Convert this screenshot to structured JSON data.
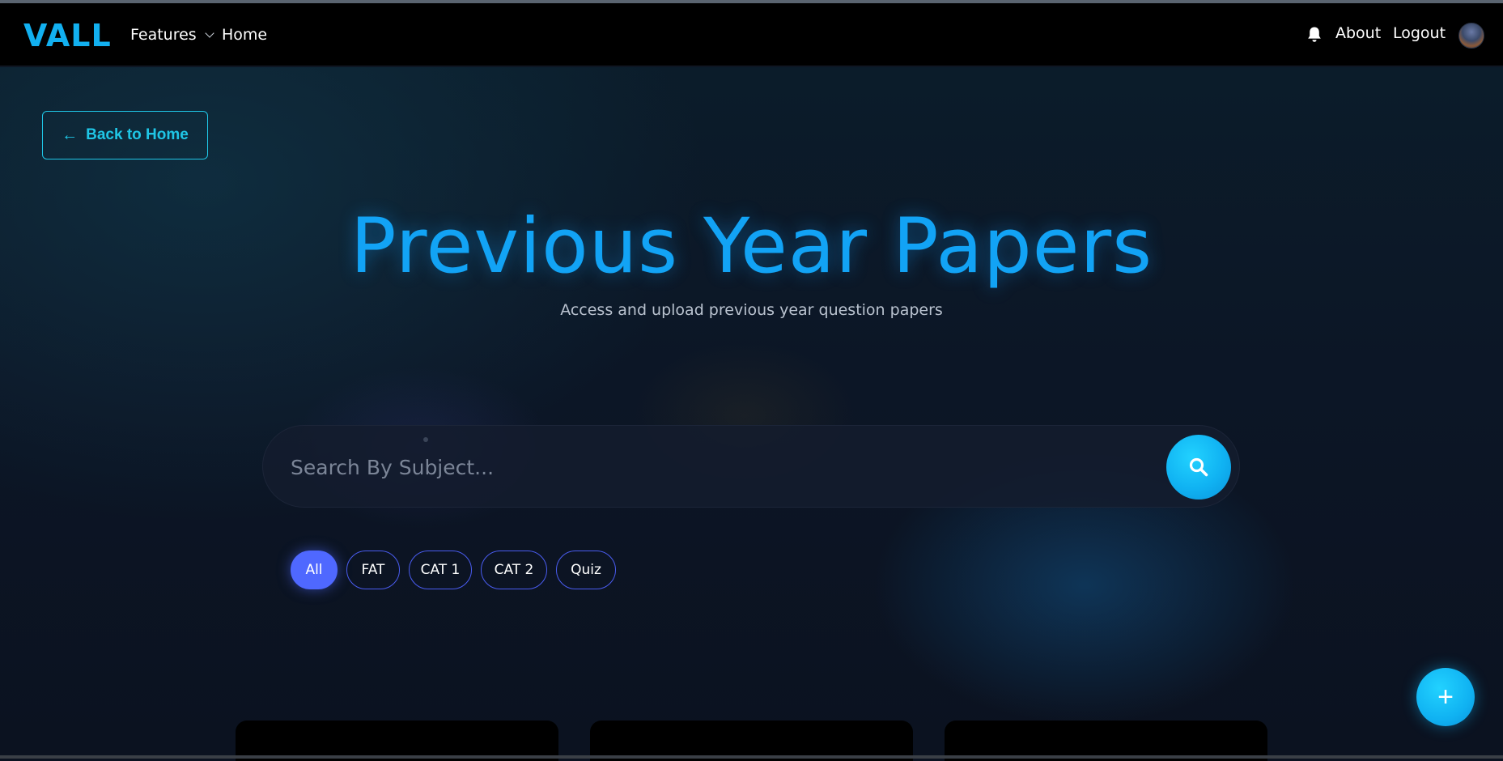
{
  "navbar": {
    "logo": "VALL",
    "features_label": "Features",
    "home_label": "Home",
    "about_label": "About",
    "logout_label": "Logout"
  },
  "back_button": {
    "arrow": "←",
    "label": "Back to Home"
  },
  "hero": {
    "title": "Previous Year Papers",
    "subtitle": "Access and upload previous year question papers"
  },
  "search": {
    "placeholder": "Search By Subject...",
    "value": ""
  },
  "filters": [
    {
      "label": "All",
      "active": true
    },
    {
      "label": "FAT",
      "active": false
    },
    {
      "label": "CAT 1",
      "active": false
    },
    {
      "label": "CAT 2",
      "active": false
    },
    {
      "label": "Quiz",
      "active": false
    }
  ],
  "fab": {
    "symbol": "+"
  },
  "colors": {
    "accent": "#12a3f5",
    "logo": "#12b0f0",
    "back_button": "#1fc6e6",
    "filter_active": "#4f68ff",
    "filter_border": "#4a5cf0",
    "background": "#0b1220"
  },
  "icons": {
    "features_dropdown": "chevron-down-icon",
    "notifications": "bell-icon",
    "search": "search-icon",
    "back": "arrow-left-icon",
    "fab": "plus-icon"
  }
}
